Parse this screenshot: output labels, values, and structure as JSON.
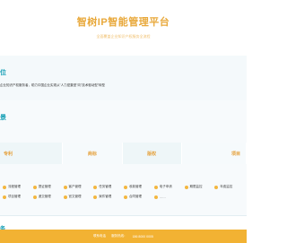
{
  "header": {
    "title": "智树IP智能管理平台",
    "subtitle": "全面覆盖企业知识产权服务全流程"
  },
  "mission": {
    "heading": "位",
    "text": "企业知识产权服务者，助力中国企业实现从\"人力密集型\"向\"技术驱动型\"转型"
  },
  "services_section": {
    "heading": "景",
    "cards": [
      {
        "label": "专利"
      },
      {
        "label": "商标"
      },
      {
        "label": "版权"
      },
      {
        "label": "项目"
      }
    ],
    "items": [
      "流程管理",
      "提证管理",
      "客户管理",
      "任务管理",
      "收款管理",
      "电子申请",
      "期限监控",
      "年费监控",
      "项目管理",
      "递交管理",
      "官文管理",
      "案件管理",
      "合同管理",
      "……"
    ]
  },
  "bottom": {
    "heading": "务"
  },
  "footer": {
    "company": "联系电话",
    "phone_label": "服务热线：",
    "phone": "186 8000 0005"
  },
  "colors": {
    "accent_orange": "#e8a83a",
    "accent_teal": "#19a0b6",
    "footer_bg": "#f2b233"
  }
}
